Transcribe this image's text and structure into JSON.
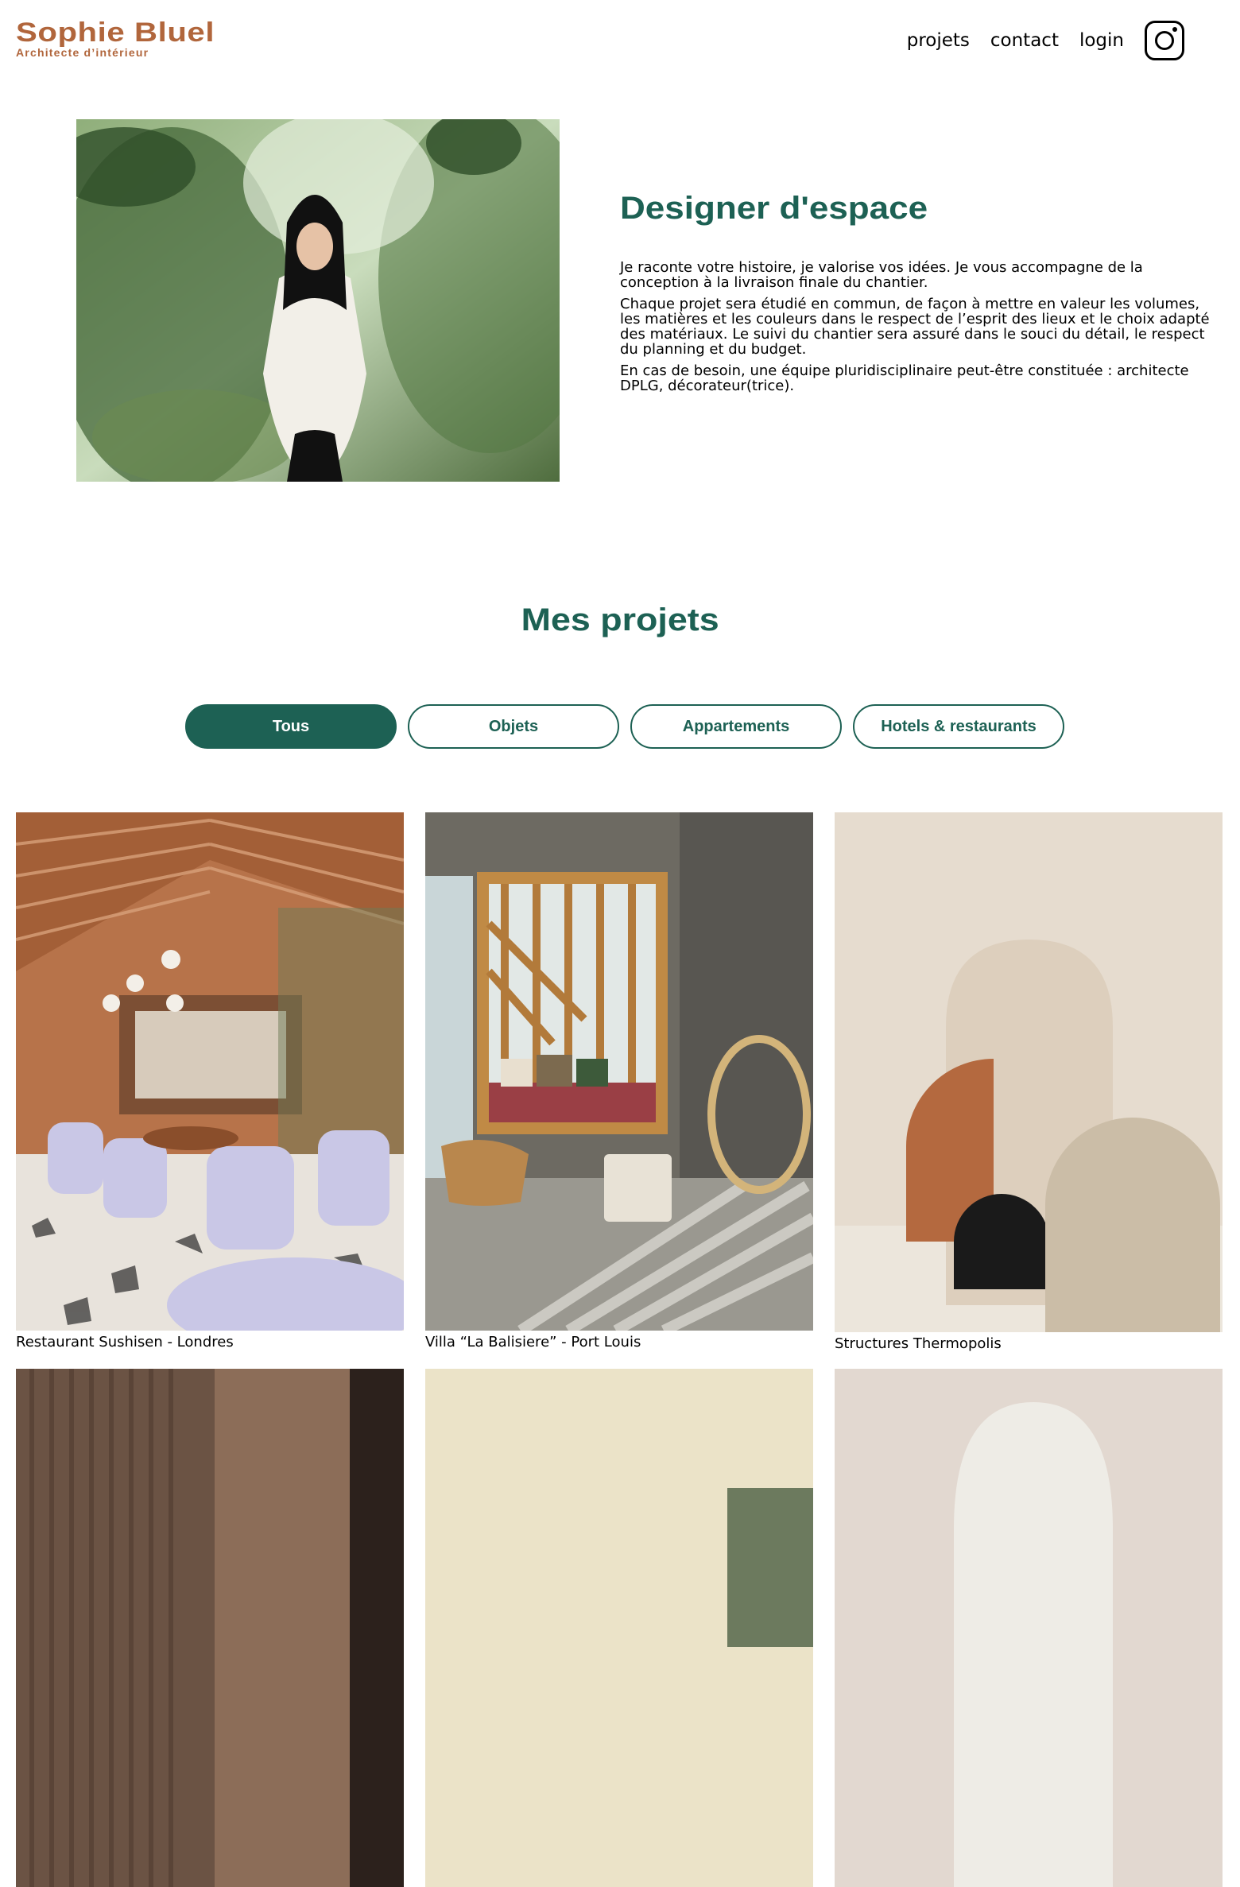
{
  "header": {
    "logo_title": "Sophie Bluel",
    "logo_subtitle": "Architecte d’intérieur",
    "nav": [
      "projets",
      "contact",
      "login"
    ],
    "social_icon": "instagram-icon"
  },
  "intro": {
    "title": "Designer d'espace",
    "paragraphs": [
      "Je raconte votre histoire, je valorise vos idées. Je vous accompagne de la conception à la livraison finale du chantier.",
      "Chaque projet sera étudié en commun, de façon à mettre en valeur les volumes, les matières et les couleurs dans le respect de l’esprit des lieux et le choix adapté des matériaux. Le suivi du chantier sera assuré dans le souci du détail, le respect du planning et du budget.",
      "En cas de besoin, une équipe pluridisciplinaire peut-être constituée : architecte DPLG, décorateur(trice)."
    ]
  },
  "projects": {
    "title": "Mes projets",
    "filters": [
      "Tous",
      "Objets",
      "Appartements",
      "Hotels & restaurants"
    ],
    "active_filter": "Tous",
    "items": [
      {
        "caption": "Restaurant Sushisen - Londres"
      },
      {
        "caption": "Villa “La Balisiere” - Port Louis"
      },
      {
        "caption": "Structures Thermopolis"
      },
      {
        "caption": ""
      },
      {
        "caption": ""
      },
      {
        "caption": ""
      }
    ]
  },
  "colors": {
    "brand": "#B1663C",
    "accent": "#1D6154"
  }
}
